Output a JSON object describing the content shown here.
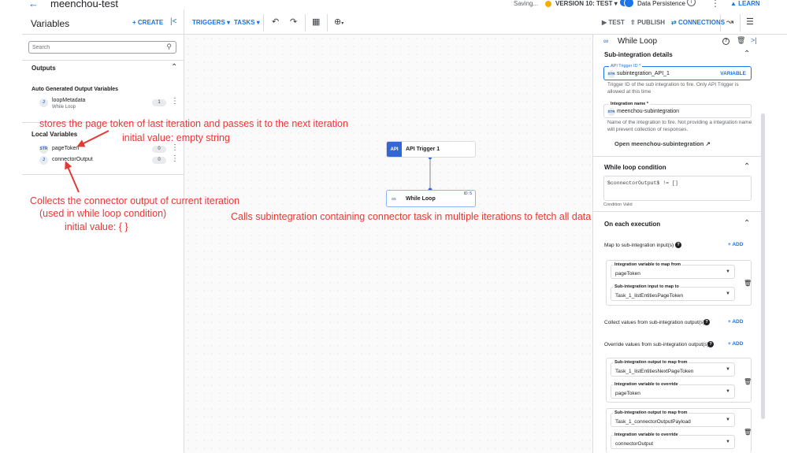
{
  "topbar": {
    "back_icon": "arrow-back-icon",
    "title": "meenchou-test",
    "saving": "Saving...",
    "version": "VERSION 10: TEST",
    "data_persistence": "Data Persistence",
    "learn": "LEARN",
    "version_dot_color": "#f9ab00"
  },
  "left_header": {
    "title": "Variables",
    "create": "+ CREATE"
  },
  "toolbar": {
    "triggers": "TRIGGERS",
    "tasks": "TASKS",
    "test": "TEST",
    "publish": "PUBLISH",
    "connections": "CONNECTIONS"
  },
  "search": {
    "placeholder": "Search"
  },
  "outputs": {
    "title": "Outputs",
    "subheading": "Auto Generated Output Variables",
    "items": [
      {
        "badge": "J",
        "name": "loopMetadata",
        "sub": "While Loop",
        "count": "1"
      }
    ]
  },
  "local_vars": {
    "title": "Local Variables",
    "items": [
      {
        "badge": "STR",
        "name": "pageToken",
        "count": "0"
      },
      {
        "badge": "J",
        "name": "connectorOutput",
        "count": "0"
      }
    ]
  },
  "canvas": {
    "trigger_node": {
      "icon": "API",
      "label": "API Trigger 1"
    },
    "loop_node": {
      "label": "While Loop",
      "id": "ID: 5"
    }
  },
  "right_panel": {
    "title": "While Loop",
    "sub_integration": {
      "title": "Sub-integration details",
      "api_trigger_label": "API Trigger ID *",
      "api_trigger_badge": "STR",
      "api_trigger_value": "subintegration_API_1",
      "variable_btn": "VARIABLE",
      "api_trigger_help": "Trigger ID of the sub integration to fire. Only API Trigger is allowed at this time",
      "integration_label": "Integration name *",
      "integration_badge": "STR",
      "integration_value": "meenchou-subintegration",
      "integration_help": "Name of the integration to fire. Not providing a integration name will prevent collection of responses.",
      "open_link": "Open meenchou-subintegration"
    },
    "loop_condition": {
      "title": "While loop condition",
      "expression": "$connectorOutput$ != []",
      "status": "Condition Valid"
    },
    "each_execution": {
      "title": "On each execution",
      "map_inputs_label": "Map to sub-integration input(s)",
      "add": "+ ADD",
      "map_card": {
        "var_label": "Integration variable to map from",
        "var_value": "pageToken",
        "input_label": "Sub-integration input to map to",
        "input_value": "Task_1_listEntitiesPageToken"
      },
      "collect_label": "Collect values from sub-integration output(s)",
      "override_label": "Override values from sub-integration output(s)",
      "override_cards": [
        {
          "out_label": "Sub-integration output to map from",
          "out_value": "Task_1_listEntitiesNextPageToken",
          "var_label": "Integration variable to override",
          "var_value": "pageToken"
        },
        {
          "out_label": "Sub-integration output to map from",
          "out_value": "Task_1_connectorOutputPayload",
          "var_label": "Integration variable to override",
          "var_value": "connectorOutput"
        }
      ]
    }
  },
  "annotations": {
    "page_token_1": "stores the page token of last iteration and passes it to the next iteration",
    "page_token_2": "initial value: empty string",
    "connector_1": "Collects the connector output of current iteration",
    "connector_2": "(used in while loop condition)",
    "connector_3": "initial value: { }",
    "canvas_note": "Calls subintegration containing connector task in multiple iterations to fetch all data",
    "color": "#e53935"
  }
}
